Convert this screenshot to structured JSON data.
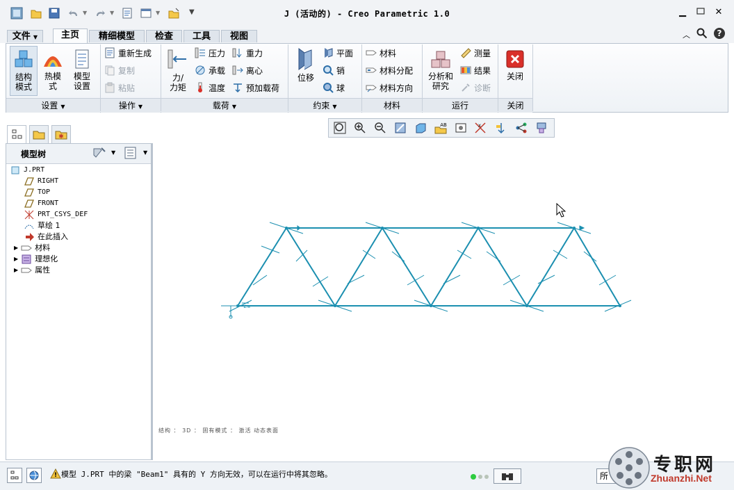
{
  "window": {
    "title": "J (活动的) - Creo Parametric 1.0"
  },
  "tabs": [
    "文件",
    "主页",
    "精细模型",
    "检查",
    "工具",
    "视图"
  ],
  "ribbon": {
    "big_buttons": {
      "struct_mode": "结构\n模式",
      "thermal_mode": "热模\n式",
      "model_setup": "模型\n设置",
      "force_moment": "力/\n力矩",
      "displacement": "位移",
      "analysis": "分析和\n研究",
      "close": "关闭"
    },
    "small_buttons": {
      "regenerate": "重新生成",
      "copy": "复制",
      "paste": "粘贴",
      "pressure": "压力",
      "bearing": "承载",
      "temperature": "温度",
      "gravity": "重力",
      "centrifugal": "离心",
      "preload": "预加载荷",
      "plane": "平面",
      "pin": "销",
      "ball": "球",
      "material": "材料",
      "material_assign": "材料分配",
      "material_orient": "材料方向",
      "measure": "测量",
      "results": "结果",
      "diagnose": "诊断"
    },
    "groups": {
      "setup": "设置",
      "operations": "操作",
      "loads": "载荷",
      "constraints": "约束",
      "materials": "材料",
      "run": "运行",
      "close": "关闭"
    }
  },
  "model_tree": {
    "title": "模型树",
    "items": [
      "J.PRT",
      "RIGHT",
      "TOP",
      "FRONT",
      "PRT_CSYS_DEF",
      "草绘 1",
      "在此插入",
      "材料",
      "理想化",
      "属性"
    ]
  },
  "viewport": {
    "status_line": "结构 ： 3D ： 固有模式 ： 激活 动态表面"
  },
  "status": {
    "message": "模型 J.PRT 中的梁 \"Beam1\" 具有的 Y 方向无效，可以在运行中将其忽略。",
    "filter_partial": "所"
  },
  "watermark": {
    "cn": "专职网",
    "url": "Zhuanzhi.Net"
  },
  "colors": {
    "truss": "#1b8fb0",
    "accent": "#2a6ebb",
    "close_red": "#d9302a"
  },
  "icons": [
    "app-icon",
    "open-icon",
    "save-icon",
    "undo-icon",
    "redo-icon",
    "regenerate-icon",
    "window-icon",
    "close-window-icon",
    "customize-icon"
  ]
}
